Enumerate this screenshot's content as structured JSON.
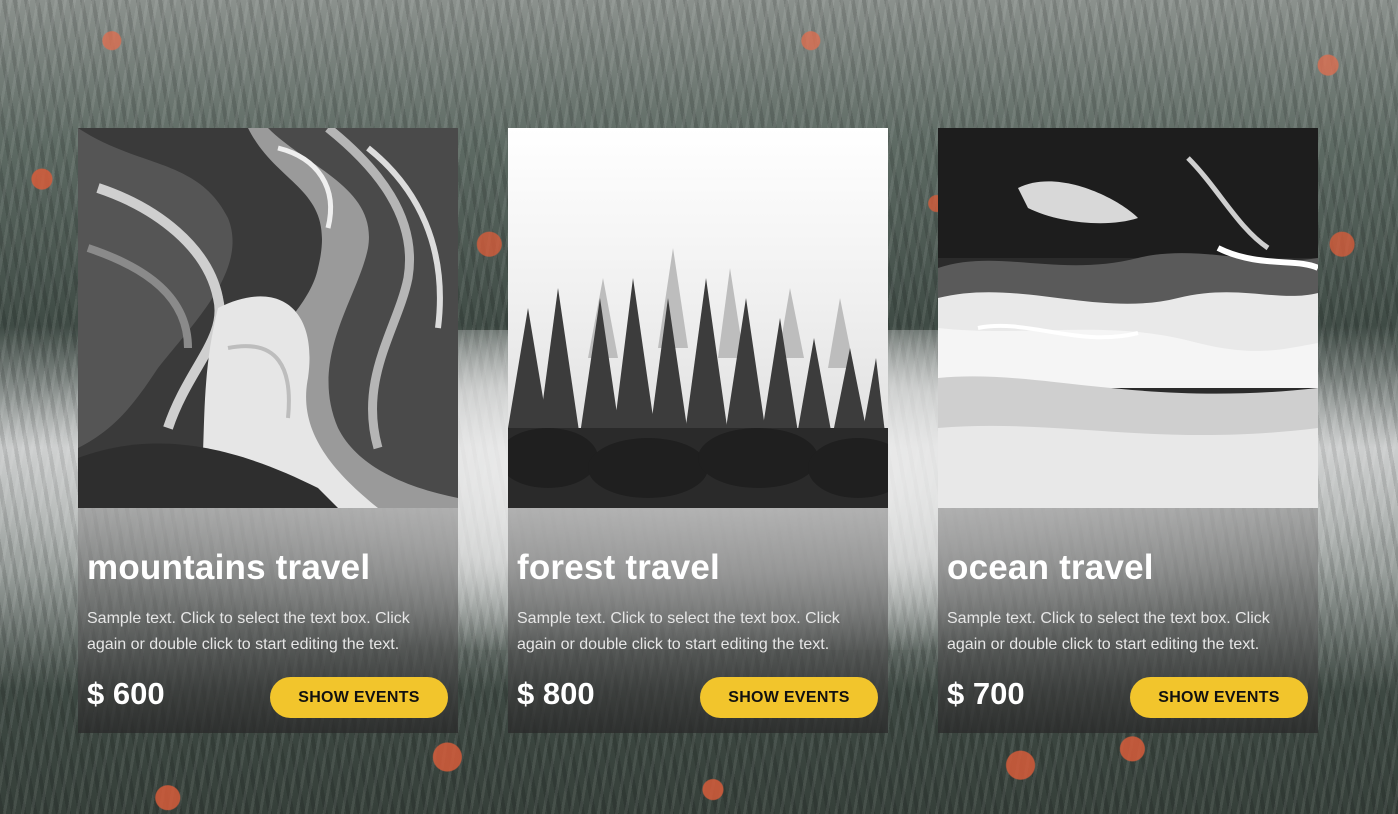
{
  "cards": [
    {
      "title": "mountains travel",
      "text": "Sample text. Click to select the text box. Click again or double click to start editing the text.",
      "price": "$ 600",
      "button": "SHOW EVENTS",
      "image": "canyon-photo"
    },
    {
      "title": "forest travel",
      "text": "Sample text. Click to select the text box. Click again or double click to start editing the text.",
      "price": "$ 800",
      "button": "SHOW EVENTS",
      "image": "foggy-forest-photo"
    },
    {
      "title": "ocean travel",
      "text": "Sample text. Click to select the text box. Click again or double click to start editing the text.",
      "price": "$ 700",
      "button": "SHOW EVENTS",
      "image": "ocean-waves-photo"
    }
  ],
  "colors": {
    "button_bg": "#f2c52c",
    "button_text": "#111111",
    "title": "#ffffff"
  }
}
